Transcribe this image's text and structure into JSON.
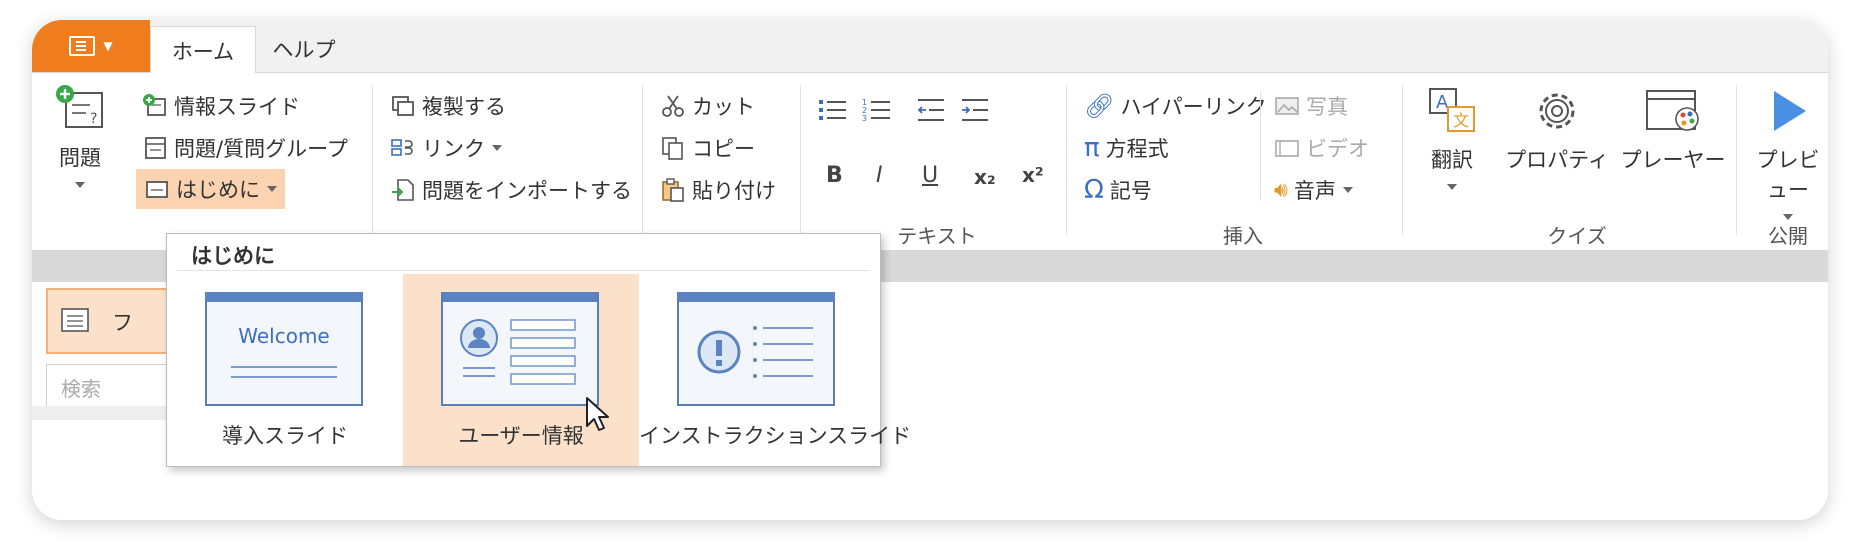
{
  "tabs": {
    "home": "ホーム",
    "help": "ヘルプ"
  },
  "ribbon": {
    "question": "問題",
    "info_slide": "情報スライド",
    "question_group": "問題/質問グループ",
    "intro": "はじめに",
    "duplicate": "複製する",
    "link": "リンク",
    "import_question": "問題をインポートする",
    "cut": "カット",
    "copy": "コピー",
    "paste": "貼り付け",
    "bold": "B",
    "italic": "I",
    "underline": "U",
    "subscript": "x₂",
    "superscript": "x²",
    "hyperlink": "ハイパーリンク",
    "equation": "方程式",
    "symbol": "記号",
    "photo": "写真",
    "video": "ビデオ",
    "audio": "音声",
    "translate": "翻訳",
    "properties": "プロパティ",
    "player": "プレーヤー",
    "preview": "プレビュー",
    "groups": {
      "text": "テキスト",
      "insert": "挿入",
      "quiz": "クイズ",
      "publish": "公開"
    }
  },
  "panel": {
    "tab_label": "フ",
    "search_placeholder": "検索"
  },
  "dropdown": {
    "title": "はじめに",
    "items": [
      {
        "label": "導入スライド",
        "thumb_text": "Welcome"
      },
      {
        "label": "ユーザー情報"
      },
      {
        "label": "インストラクションスライド"
      }
    ]
  },
  "colors": {
    "accent": "#ef7d1e",
    "highlight": "#fbd3b0",
    "slide_blue": "#5b83c2"
  }
}
